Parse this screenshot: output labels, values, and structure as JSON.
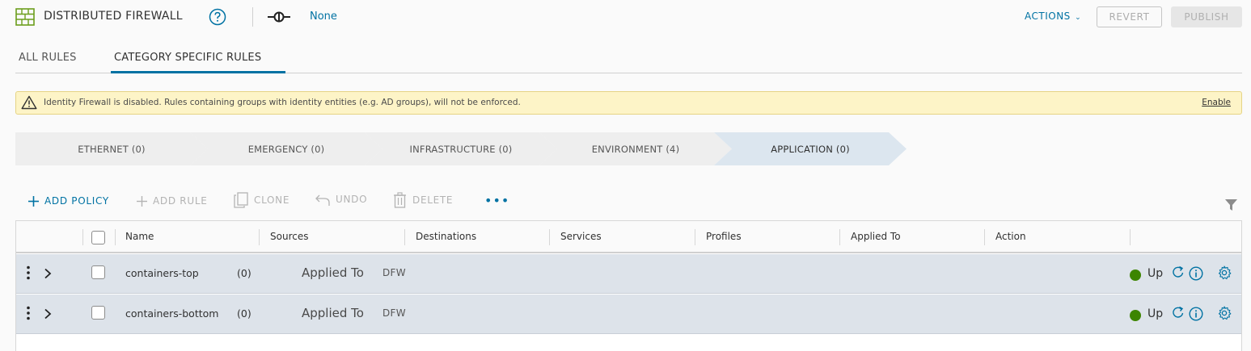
{
  "header": {
    "title": "DISTRIBUTED FIREWALL",
    "connection_value": "None",
    "actions_label": "ACTIONS",
    "revert_label": "REVERT",
    "publish_label": "PUBLISH"
  },
  "tabs": [
    {
      "label": "ALL RULES",
      "active": false
    },
    {
      "label": "CATEGORY SPECIFIC RULES",
      "active": true
    }
  ],
  "banner": {
    "text": "Identity Firewall is disabled. Rules containing groups with identity entities (e.g. AD groups), will not be enforced.",
    "link": "Enable"
  },
  "categories": [
    {
      "label": "ETHERNET (0)",
      "active": false
    },
    {
      "label": "EMERGENCY (0)",
      "active": false
    },
    {
      "label": "INFRASTRUCTURE (0)",
      "active": false
    },
    {
      "label": "ENVIRONMENT (4)",
      "active": false
    },
    {
      "label": "APPLICATION (0)",
      "active": true
    }
  ],
  "toolbar": {
    "add_policy": "ADD POLICY",
    "add_rule": "ADD RULE",
    "clone": "CLONE",
    "undo": "UNDO",
    "delete": "DELETE",
    "more": "•••"
  },
  "table": {
    "columns": [
      "Name",
      "Sources",
      "Destinations",
      "Services",
      "Profiles",
      "Applied To",
      "Action"
    ],
    "rows": [
      {
        "name": "containers-top",
        "count": "(0)",
        "applied_label": "Applied To",
        "applied_value": "DFW",
        "status": "Up"
      },
      {
        "name": "containers-bottom",
        "count": "(0)",
        "applied_label": "Applied To",
        "applied_value": "DFW",
        "status": "Up"
      }
    ]
  },
  "colors": {
    "accent": "#0072a3",
    "status_up": "#3c8500",
    "banner_bg": "#fdf4c7",
    "row_bg": "#dde3ea",
    "firewall_icon": "#6c9e1c"
  },
  "icons": {
    "firewall": "firewall-brick-icon",
    "help": "help-circle-icon",
    "connection": "connection-icon",
    "warning": "warning-triangle-icon",
    "filter": "filter-icon",
    "row_menu": "kebab-icon",
    "expand": "chevron-right-icon",
    "refresh": "refresh-icon",
    "info": "info-icon",
    "settings": "gear-icon"
  }
}
